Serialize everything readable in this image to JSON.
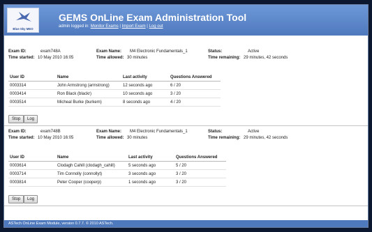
{
  "app": {
    "title": "GEMS OnLine Exam Administration Tool",
    "logo_text": "Blue Sky MEO",
    "logged_in_text": "admin logged in:",
    "nav": [
      {
        "label": "Monitor Exams",
        "sep": " | "
      },
      {
        "label": "Import Exam",
        "sep": " | "
      },
      {
        "label": "Log out",
        "sep": ""
      }
    ]
  },
  "labels": {
    "exam_id": "Exam ID:",
    "exam_name": "Exam Name:",
    "status": "Status:",
    "time_started": "Time started:",
    "time_allowed": "Time allowed:",
    "time_remaining": "Time remaining:",
    "col_user_id": "User ID",
    "col_name": "Name",
    "col_last_activity": "Last activity",
    "col_questions": "Questions Answered",
    "stop": "Stop",
    "log": "Log"
  },
  "exams": [
    {
      "exam_id": "exam748A",
      "exam_name": "M4 Electronic Fundamentals_1",
      "status": "Active",
      "time_started": "10 May 2010 16:05",
      "time_allowed": "30 minutes",
      "time_remaining": "29 minutes, 42 seconds",
      "users": [
        {
          "user_id": "0003314",
          "name": "John Armstrong (armstrong)",
          "last_activity": "12 seconds ago",
          "questions": "6 / 20"
        },
        {
          "user_id": "0003414",
          "name": "Ron Black (blackr)",
          "last_activity": "10 seconds ago",
          "questions": "3 / 20"
        },
        {
          "user_id": "0003514",
          "name": "Micheal Burke (burkem)",
          "last_activity": "8 seconds ago",
          "questions": "4 / 20"
        }
      ]
    },
    {
      "exam_id": "exam748B",
      "exam_name": "M4 Electronic Fundamentals_1",
      "status": "Active",
      "time_started": "10 May 2010 16:05",
      "time_allowed": "30 minutes",
      "time_remaining": "29 minutes, 42 seconds",
      "users": [
        {
          "user_id": "0003614",
          "name": "Clodagh Cahill (clodagh_cahill)",
          "last_activity": "5 seconds ago",
          "questions": "5 / 20"
        },
        {
          "user_id": "0003714",
          "name": "Tim Connolly (connollyt)",
          "last_activity": "3 seconds ago",
          "questions": "3 / 20"
        },
        {
          "user_id": "0003814",
          "name": "Peter Cooper (cooperp)",
          "last_activity": "1 seconds ago",
          "questions": "3 / 20"
        }
      ]
    }
  ],
  "footer": "ASTech OnLine Exam Module, version 0.7.7. © 2010 ASTech."
}
